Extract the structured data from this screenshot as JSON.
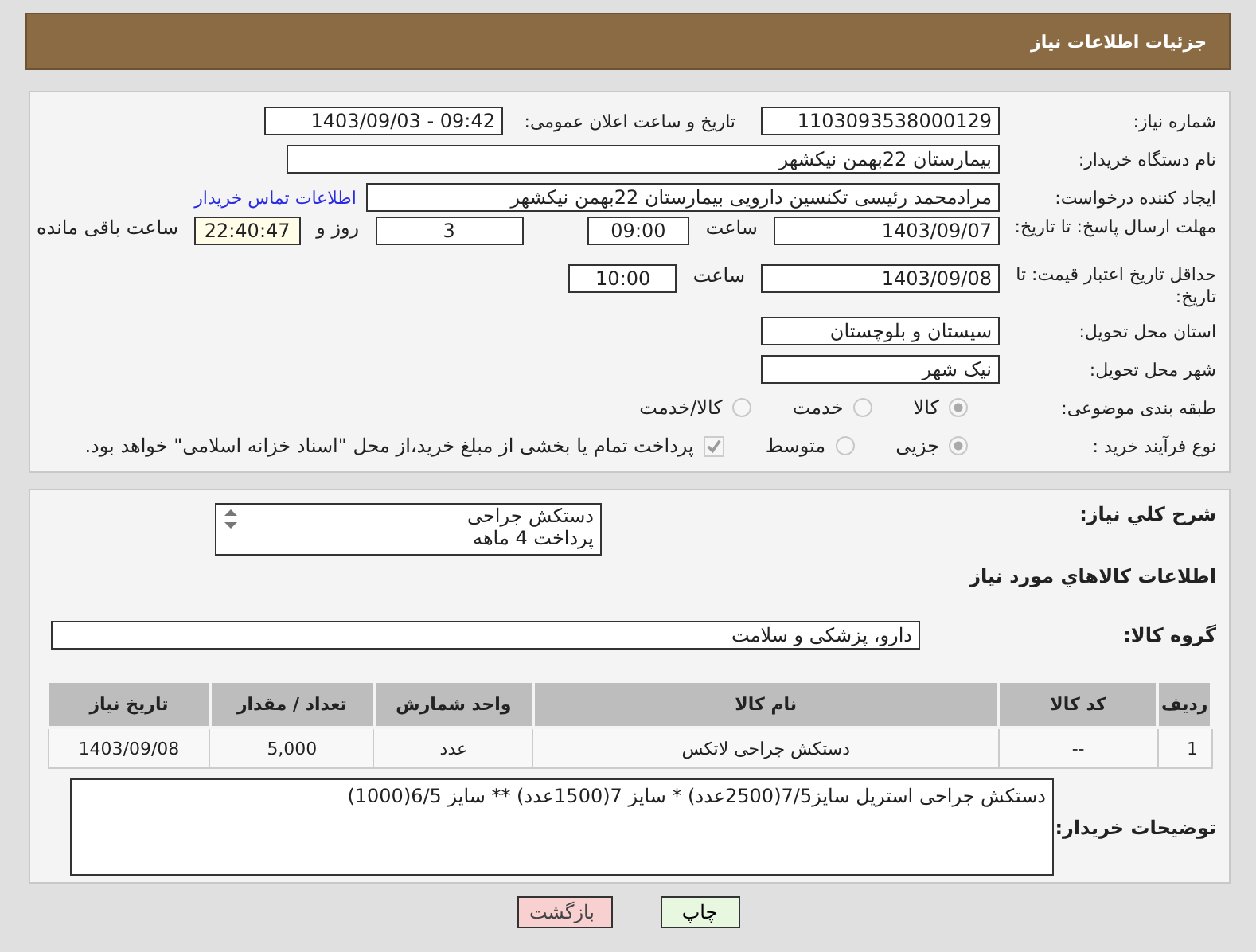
{
  "header": {
    "title": "جزئیات اطلاعات نیاز"
  },
  "info": {
    "need_number": {
      "label": "شماره نیاز:",
      "value": "1103093538000129"
    },
    "announce": {
      "label": "تاریخ و ساعت اعلان عمومی:",
      "value": "1403/09/03 - 09:42"
    },
    "buyer": {
      "label": "نام دستگاه خریدار:",
      "value": "بیمارستان 22بهمن نیکشهر"
    },
    "creator": {
      "label": "ایجاد کننده درخواست:",
      "value": "مرادمحمد رئیسی تکنسین دارویی بیمارستان 22بهمن نیکشهر",
      "link": "اطلاعات تماس خریدار"
    },
    "deadline": {
      "label": "مهلت ارسال پاسخ: تا تاریخ:",
      "date": "1403/09/07",
      "time_label": "ساعت",
      "time": "09:00",
      "days": "3",
      "days_label": "روز و",
      "remaining": "22:40:47",
      "remaining_label": "ساعت باقی مانده"
    },
    "validity": {
      "label": "حداقل تاریخ اعتبار قیمت: تا تاریخ:",
      "date": "1403/09/08",
      "time_label": "ساعت",
      "time": "10:00"
    },
    "province": {
      "label": "استان محل تحویل:",
      "value": "سیستان و بلوچستان"
    },
    "city": {
      "label": "شهر محل تحویل:",
      "value": "نیک شهر"
    },
    "category": {
      "label": "طبقه بندی موضوعی:",
      "options": [
        {
          "label": "کالا",
          "selected": true
        },
        {
          "label": "خدمت",
          "selected": false
        },
        {
          "label": "کالا/خدمت",
          "selected": false
        }
      ]
    },
    "process": {
      "label": "نوع فرآیند خرید :",
      "options": [
        {
          "label": "جزیی",
          "selected": true
        },
        {
          "label": "متوسط",
          "selected": false
        }
      ],
      "payment": {
        "checked": true,
        "text": "پرداخت تمام یا بخشی از مبلغ خرید،از محل \"اسناد خزانه اسلامی\" خواهد بود."
      }
    }
  },
  "goods": {
    "summary": {
      "label": "شرح کلي نياز:",
      "lines": [
        "دستکش جراحی",
        "پرداخت 4 ماهه"
      ]
    },
    "heading": "اطلاعات كالاهاي مورد نياز",
    "group": {
      "label": "گروه کالا:",
      "value": "دارو، پزشکی و سلامت"
    },
    "table": {
      "columns": [
        "ردیف",
        "کد کالا",
        "نام کالا",
        "واحد شمارش",
        "تعداد / مقدار",
        "تاریخ نیاز"
      ],
      "rows": [
        [
          "1",
          "--",
          "دستکش جراحی لاتکس",
          "عدد",
          "5,000",
          "1403/09/08"
        ]
      ]
    },
    "notes": {
      "label": "توضیحات خریدار:",
      "value": "دستکش جراحی استریل سایز7/5(2500عدد) * سایز 7(1500عدد) ** سایز 6/5(1000)"
    }
  },
  "buttons": [
    {
      "label": "چاپ",
      "kind": "print"
    },
    {
      "label": "بازگشت",
      "kind": "back"
    }
  ]
}
